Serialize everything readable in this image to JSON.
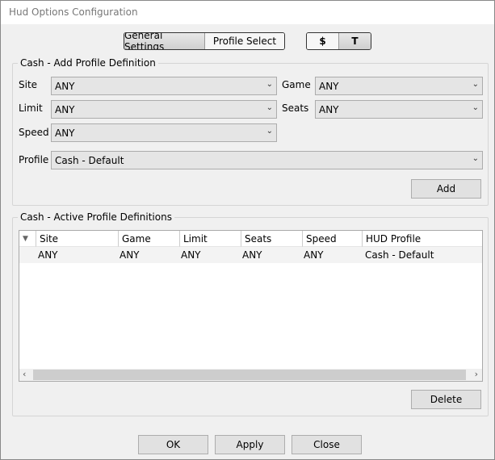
{
  "window": {
    "title": "Hud Options Configuration"
  },
  "tabs": {
    "general": "General Settings",
    "profile": "Profile Select"
  },
  "mode": {
    "cash": "$",
    "tournament": "T"
  },
  "add_group": {
    "title": "Cash - Add Profile Definition",
    "site_label": "Site",
    "site_value": "ANY",
    "game_label": "Game",
    "game_value": "ANY",
    "limit_label": "Limit",
    "limit_value": "ANY",
    "seats_label": "Seats",
    "seats_value": "ANY",
    "speed_label": "Speed",
    "speed_value": "ANY",
    "profile_label": "Profile",
    "profile_value": "Cash - Default",
    "add_label": "Add"
  },
  "active_group": {
    "title": "Cash - Active Profile Definitions",
    "columns": [
      "Site",
      "Game",
      "Limit",
      "Seats",
      "Speed",
      "HUD Profile"
    ],
    "rows": [
      [
        "ANY",
        "ANY",
        "ANY",
        "ANY",
        "ANY",
        "Cash - Default"
      ]
    ],
    "delete_label": "Delete"
  },
  "footer": {
    "ok": "OK",
    "apply": "Apply",
    "close": "Close"
  }
}
